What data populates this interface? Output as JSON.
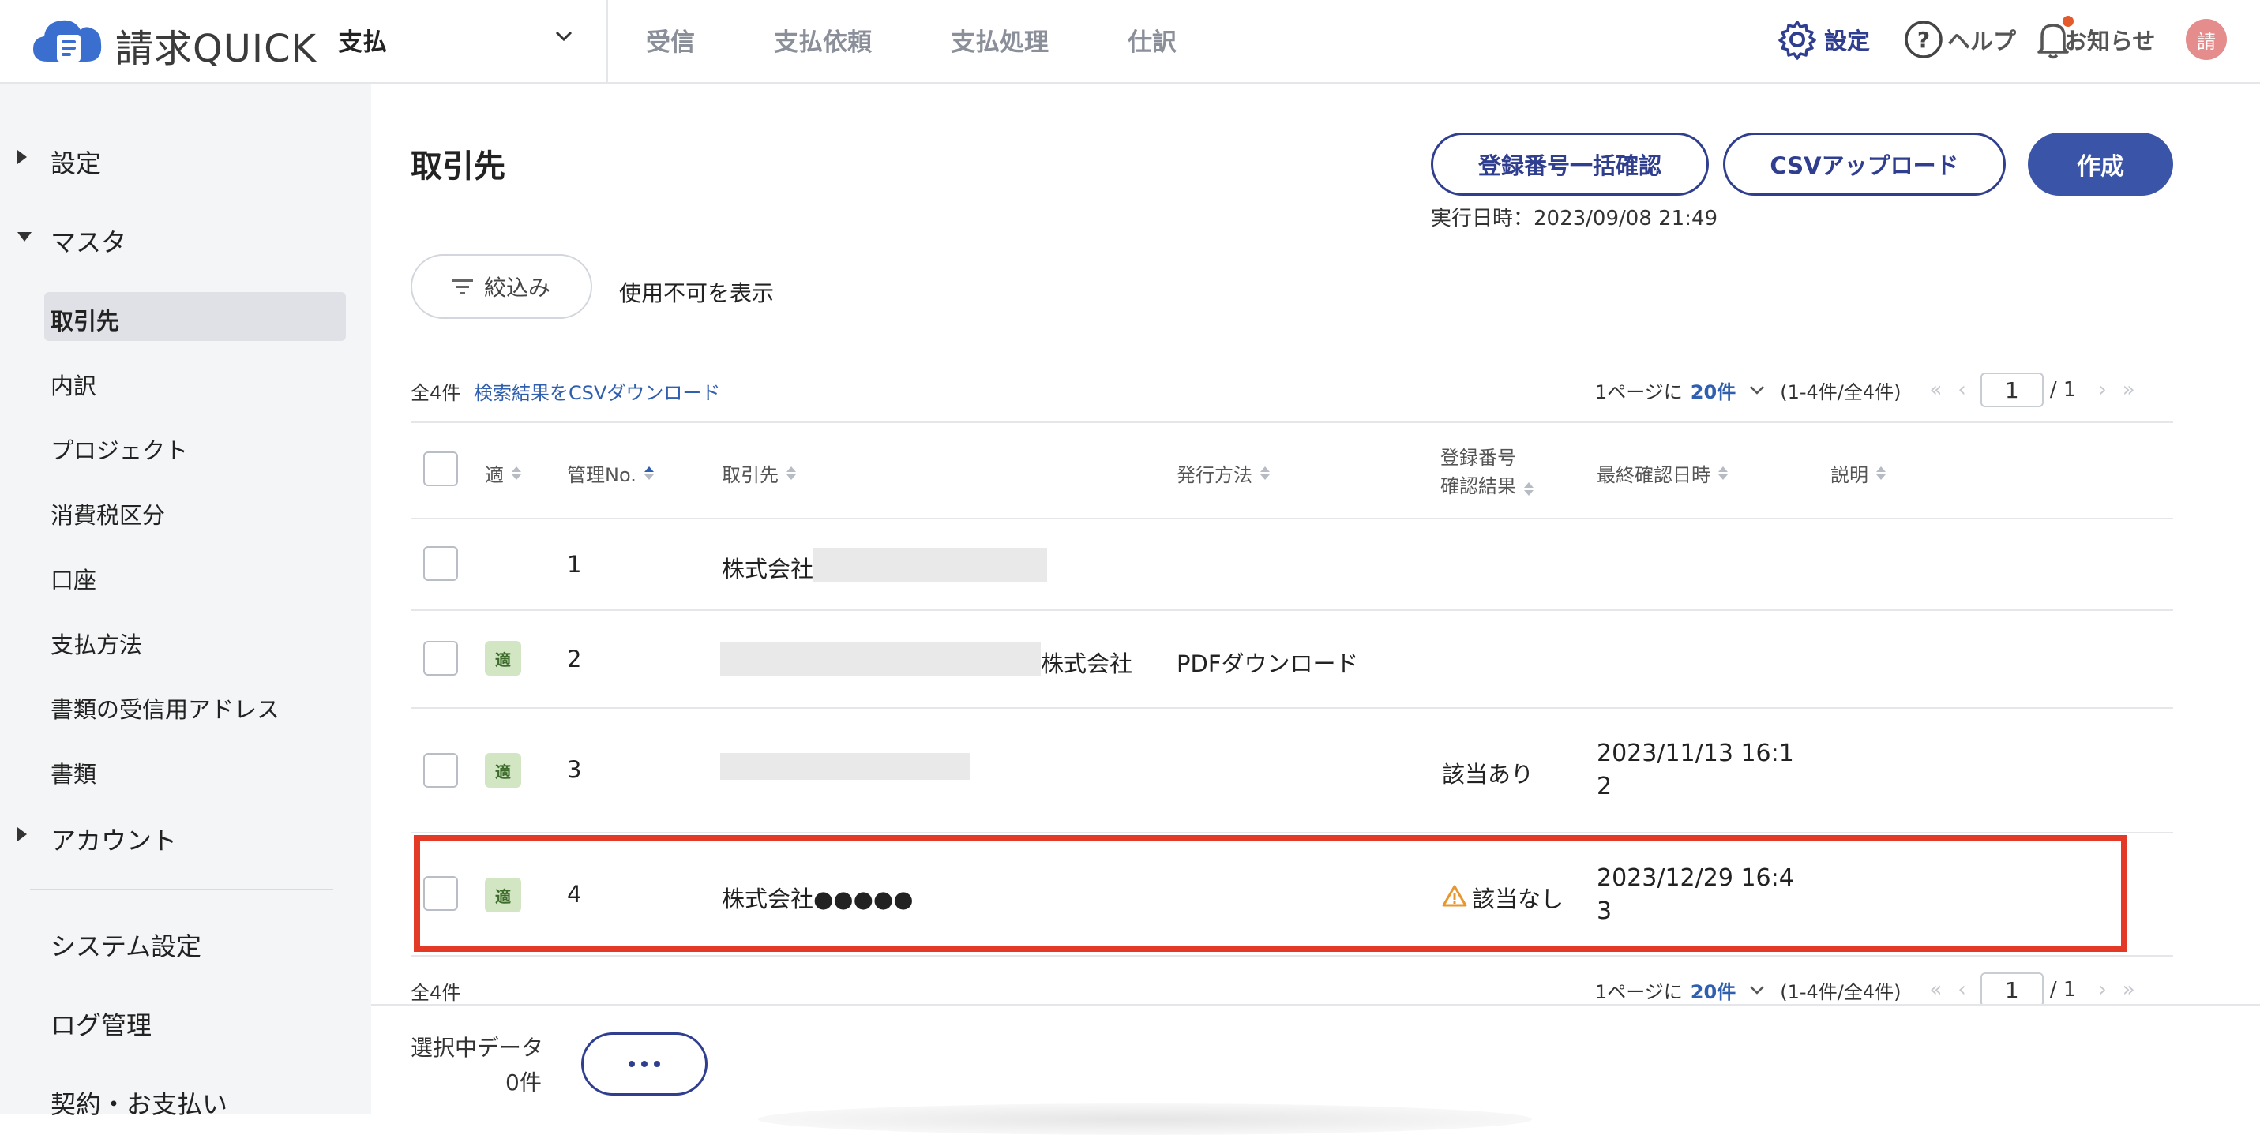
{
  "app": {
    "name": "請求QUICK",
    "module": "支払"
  },
  "nav": {
    "items": [
      "受信",
      "支払依頼",
      "支払処理",
      "仕訳"
    ]
  },
  "header_right": {
    "settings": "設定",
    "help": "ヘルプ",
    "notifications": "お知らせ",
    "avatar": "請"
  },
  "sidebar": {
    "settings": "設定",
    "master": "マスタ",
    "sub_items": [
      "取引先",
      "内訳",
      "プロジェクト",
      "消費税区分",
      "口座",
      "支払方法",
      "書類の受信用アドレス",
      "書類"
    ],
    "account": "アカウント",
    "system_settings": "システム設定",
    "log_management": "ログ管理",
    "contract": "契約・お支払い"
  },
  "page": {
    "title": "取引先",
    "buttons": {
      "bulk_check": "登録番号一括確認",
      "csv_upload": "CSVアップロード",
      "create": "作成"
    },
    "exec_time": "実行日時：2023/09/08 21:49",
    "filter_label": "絞込み",
    "show_disabled": "使用不可を表示",
    "total": "全4件",
    "csv_download": "検索結果をCSVダウンロード",
    "pagination": {
      "per_page_prefix": "1ページに",
      "per_page_value": "20件",
      "range": "(1-4件/全4件)",
      "page_current": "1",
      "page_total": "/ 1"
    }
  },
  "table": {
    "headers": {
      "fit": "適",
      "no": "管理No.",
      "partner": "取引先",
      "method": "発行方法",
      "reg_line1": "登録番号",
      "reg_line2": "確認結果",
      "last_checked": "最終確認日時",
      "description": "説明"
    },
    "rows": [
      {
        "no": "1",
        "badge": "",
        "partner": "株式会社",
        "method": "",
        "reg_result": "",
        "last_checked_l1": "",
        "last_checked_l2": ""
      },
      {
        "no": "2",
        "badge": "適",
        "partner": "株式会社",
        "method": "PDFダウンロード",
        "reg_result": "",
        "last_checked_l1": "",
        "last_checked_l2": ""
      },
      {
        "no": "3",
        "badge": "適",
        "partner": "",
        "method": "",
        "reg_result": "該当あり",
        "last_checked_l1": "2023/11/13 16:1",
        "last_checked_l2": "2"
      },
      {
        "no": "4",
        "badge": "適",
        "partner": "株式会社●●●●●",
        "method": "",
        "reg_result": "該当なし",
        "last_checked_l1": "2023/12/29 16:4",
        "last_checked_l2": "3"
      }
    ]
  },
  "footer": {
    "selected_label": "選択中データ",
    "selected_count": "0件"
  },
  "colors": {
    "primary": "#3a55a8",
    "navy": "#2f3e8f",
    "link": "#2f5fae",
    "highlight": "#e33a28",
    "badge_bg": "#d3e6c3"
  }
}
